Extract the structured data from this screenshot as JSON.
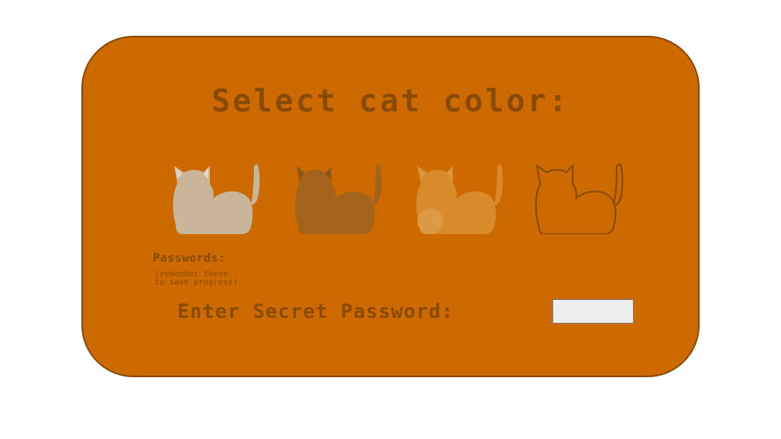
{
  "title": "Select cat color:",
  "cats": [
    {
      "name": "cream-cat",
      "fill": "#c9b59a",
      "ears": "#e6d6c2"
    },
    {
      "name": "brown-cat",
      "fill": "#a4621a",
      "ears": "#8f5212"
    },
    {
      "name": "ginger-cat",
      "fill": "#d98a2a",
      "ears": "#e0993f"
    },
    {
      "name": "outline-cat",
      "stroke": "#8a4a06"
    }
  ],
  "passwords": {
    "label": "Passwords:",
    "hint": "(remember these\nto save progress)"
  },
  "password_entry": {
    "label": "Enter Secret Password:",
    "value": ""
  },
  "colors": {
    "background": "#ffffff",
    "panel": "#cc6a00",
    "panel_border": "#8a4a06",
    "text": "#8a4a06",
    "input_bg": "#eeeeee"
  }
}
